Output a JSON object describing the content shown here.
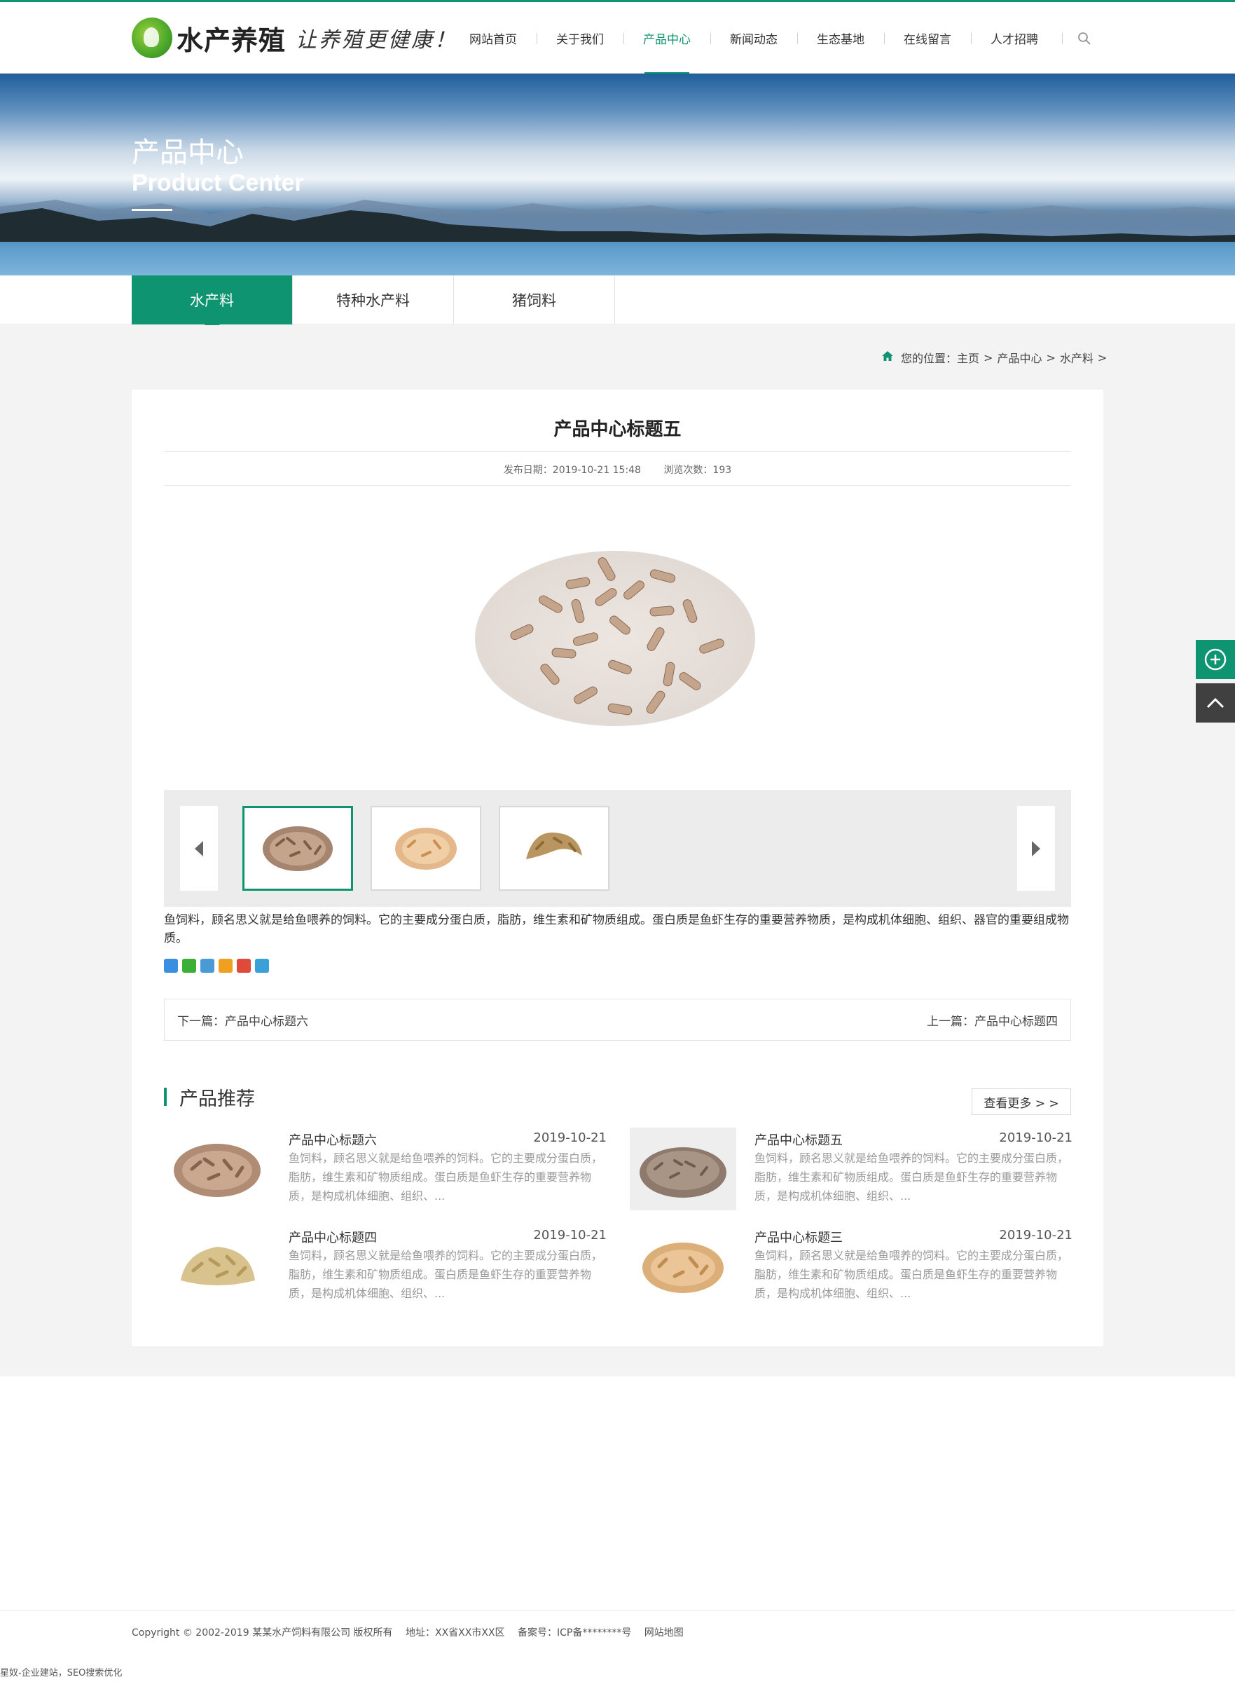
{
  "header": {
    "logo_text": "水产养殖",
    "slogan": "让养殖更健康！",
    "nav": [
      {
        "label": "网站首页"
      },
      {
        "label": "关于我们"
      },
      {
        "label": "产品中心"
      },
      {
        "label": "新闻动态"
      },
      {
        "label": "生态基地"
      },
      {
        "label": "在线留言"
      },
      {
        "label": "人才招聘"
      }
    ],
    "active_nav": "产品中心",
    "search_icon": "search-icon"
  },
  "banner": {
    "title_cn": "产品中心",
    "title_en": "Product Center"
  },
  "subnav": {
    "tabs": [
      {
        "label": "水产料"
      },
      {
        "label": "特种水产料"
      },
      {
        "label": "猪饲料"
      }
    ],
    "active": "水产料"
  },
  "breadcrumb": {
    "prefix": "您的位置：",
    "home": "主页",
    "sep": ">",
    "level1": "产品中心",
    "level2": "水产料"
  },
  "article": {
    "title": "产品中心标题五",
    "date_label": "发布日期：2019-10-21 15:48",
    "views_label": "浏览次数：193",
    "description": "鱼饲料，顾名思义就是给鱼喂养的饲料。它的主要成分蛋白质，脂肪，维生素和矿物质组成。蛋白质是鱼虾生存的重要营养物质，是构成机体细胞、组织、器官的重要组成物质。",
    "next_label": "下一篇：产品中心标题六",
    "prev_label": "上一篇：产品中心标题四"
  },
  "recommend": {
    "title": "产品推荐",
    "more_label": "查看更多 > >",
    "items": [
      {
        "name": "产品中心标题六",
        "date": "2019-10-21",
        "text": "鱼饲料，顾名思义就是给鱼喂养的饲料。它的主要成分蛋白质，脂肪，维生素和矿物质组成。蛋白质是鱼虾生存的重要营养物质，是构成机体细胞、组织、..."
      },
      {
        "name": "产品中心标题五",
        "date": "2019-10-21",
        "text": "鱼饲料，顾名思义就是给鱼喂养的饲料。它的主要成分蛋白质，脂肪，维生素和矿物质组成。蛋白质是鱼虾生存的重要营养物质，是构成机体细胞、组织、..."
      },
      {
        "name": "产品中心标题四",
        "date": "2019-10-21",
        "text": "鱼饲料，顾名思义就是给鱼喂养的饲料。它的主要成分蛋白质，脂肪，维生素和矿物质组成。蛋白质是鱼虾生存的重要营养物质，是构成机体细胞、组织、..."
      },
      {
        "name": "产品中心标题三",
        "date": "2019-10-21",
        "text": "鱼饲料，顾名思义就是给鱼喂养的饲料。它的主要成分蛋白质，脂肪，维生素和矿物质组成。蛋白质是鱼虾生存的重要营养物质，是构成机体细胞、组织、..."
      }
    ]
  },
  "footer": {
    "copyright": "Copyright © 2002-2019 某某水产饲料有限公司 版权所有",
    "address": "地址：XX省XX市XX区",
    "icp": "备案号：ICP备********号",
    "sitemap": "网站地图",
    "bottom_note": "星奴-企业建站，SEO搜索优化"
  },
  "colors": {
    "accent": "#0e9470",
    "dark_button": "#404040",
    "page_bg": "#f3f3f3"
  }
}
